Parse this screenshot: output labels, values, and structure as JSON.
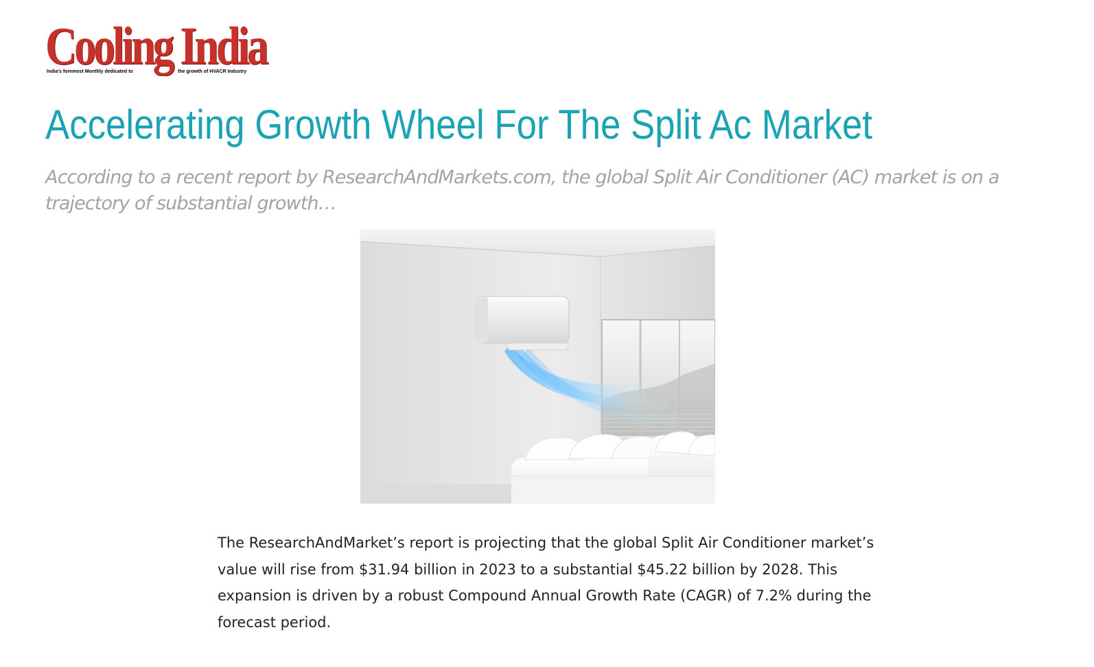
{
  "logo": {
    "wordmark": "Cooling India",
    "tagline_left": "India's foremost Monthly dedicated to",
    "tagline_right": "the growth of HVACR Industry",
    "brand_color": "#c7312b"
  },
  "article": {
    "title": "Accelerating Growth Wheel For The Split Ac Market",
    "subtitle": "According to a recent report by ResearchAndMarkets.com, the global Split Air Conditioner (AC) market is on a trajectory of substantial growth…",
    "body": "The ResearchAndMarket’s report is projecting that the global Split Air Conditioner market’s value will rise from $31.94 billion in 2023 to a substantial $45.22 billion by 2028. This expansion is driven by a robust Compound Annual Growth Rate (CAGR) of 7.2% during the forecast period.",
    "title_color": "#1aa3b4",
    "subtitle_color": "#a3a3a3"
  }
}
